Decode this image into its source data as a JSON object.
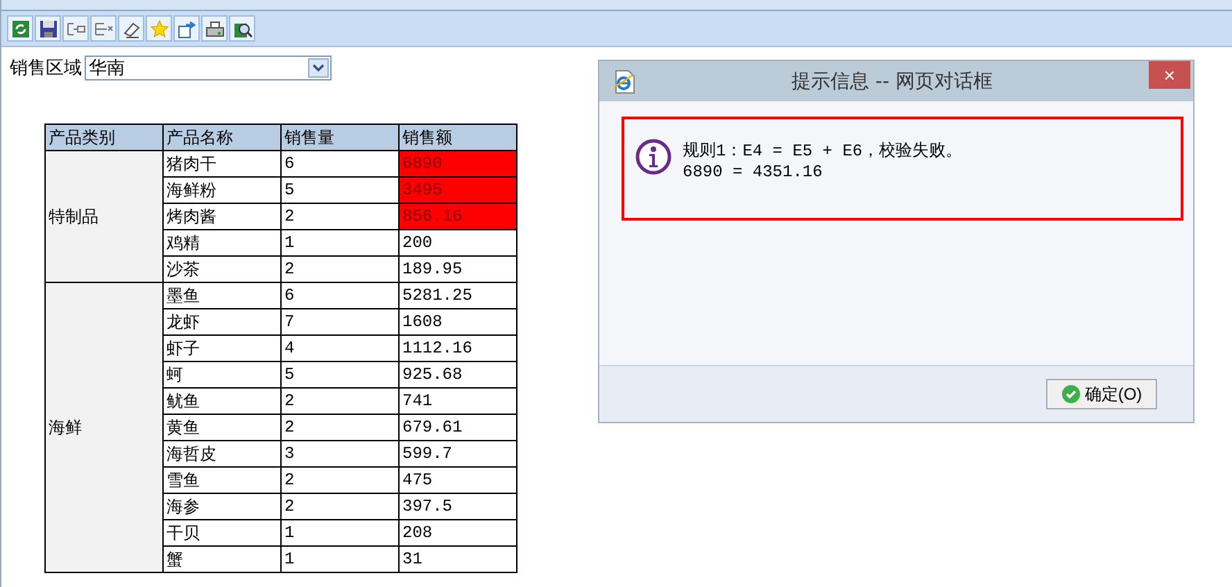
{
  "toolbar": [
    {
      "kind": "refresh"
    },
    {
      "kind": "save"
    },
    {
      "kind": "insert"
    },
    {
      "kind": "delete"
    },
    {
      "kind": "eraser"
    },
    {
      "kind": "star"
    },
    {
      "kind": "export"
    },
    {
      "kind": "print"
    },
    {
      "kind": "preview"
    }
  ],
  "filter": {
    "label": "销售区域",
    "value": "华南"
  },
  "table": {
    "columns": [
      "产品类别",
      "产品名称",
      "销售量",
      "销售额"
    ],
    "groups": [
      {
        "category": "特制品",
        "rows": [
          {
            "name": "猪肉干",
            "qty": "6",
            "amount": "6890",
            "flagged": true
          },
          {
            "name": "海鲜粉",
            "qty": "5",
            "amount": "3495",
            "flagged": true
          },
          {
            "name": "烤肉酱",
            "qty": "2",
            "amount": "856.16",
            "flagged": true
          },
          {
            "name": "鸡精",
            "qty": "1",
            "amount": "200",
            "flagged": false
          },
          {
            "name": "沙茶",
            "qty": "2",
            "amount": "189.95",
            "flagged": false
          }
        ]
      },
      {
        "category": "海鲜",
        "rows": [
          {
            "name": "墨鱼",
            "qty": "6",
            "amount": "5281.25",
            "flagged": false
          },
          {
            "name": "龙虾",
            "qty": "7",
            "amount": "1608",
            "flagged": false
          },
          {
            "name": "虾子",
            "qty": "4",
            "amount": "1112.16",
            "flagged": false
          },
          {
            "name": "蚵",
            "qty": "5",
            "amount": "925.68",
            "flagged": false
          },
          {
            "name": "鱿鱼",
            "qty": "2",
            "amount": "741",
            "flagged": false
          },
          {
            "name": "黄鱼",
            "qty": "2",
            "amount": "679.61",
            "flagged": false
          },
          {
            "name": "海哲皮",
            "qty": "3",
            "amount": "599.7",
            "flagged": false
          },
          {
            "name": "雪鱼",
            "qty": "2",
            "amount": "475",
            "flagged": false
          },
          {
            "name": "海参",
            "qty": "2",
            "amount": "397.5",
            "flagged": false
          },
          {
            "name": "干贝",
            "qty": "1",
            "amount": "208",
            "flagged": false
          },
          {
            "name": "蟹",
            "qty": "1",
            "amount": "31",
            "flagged": false
          }
        ]
      }
    ]
  },
  "dialog": {
    "title": "提示信息 -- 网页对话框",
    "close": "×",
    "message": [
      "规则1：E4 = E5 + E6，校验失败。",
      "6890 = 4351.16"
    ],
    "button": "确定(O)"
  }
}
